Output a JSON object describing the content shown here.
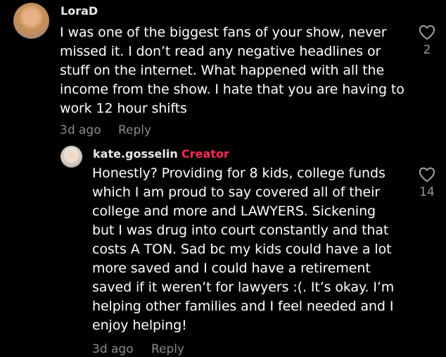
{
  "comment": {
    "username": "LoraD",
    "lines": [
      "I was one of the biggest fans of your show, never",
      "missed it. I don’t read any negative headlines or",
      "stuff on the internet. What happened with all the",
      "income from the show. I hate that you are having to",
      "work 12 hour shifts"
    ],
    "date": "3d ago",
    "reply_label": "Reply",
    "like_count": "2"
  },
  "reply": {
    "username": "kate.gosselin",
    "separator": "·",
    "badge": "Creator",
    "lines": [
      "Honestly? Providing for 8 kids, college funds",
      "which I am proud to say covered all of their",
      "college and more and LAWYERS. Sickening",
      "but I was drug into court constantly and that",
      "costs A TON. Sad bc my kids could have a lot",
      "more saved and I could have a retirement",
      "saved if it weren’t for lawyers :(. It’s okay. I’m",
      "helping other families and I feel needed and I",
      "enjoy helping!"
    ],
    "date": "3d ago",
    "reply_label": "Reply",
    "like_count": "14"
  },
  "colors": {
    "background": "#000000",
    "creator_badge": "#fe2c55",
    "muted": "#8a8a8a"
  },
  "icons": {
    "like": "heart-outline-icon"
  }
}
